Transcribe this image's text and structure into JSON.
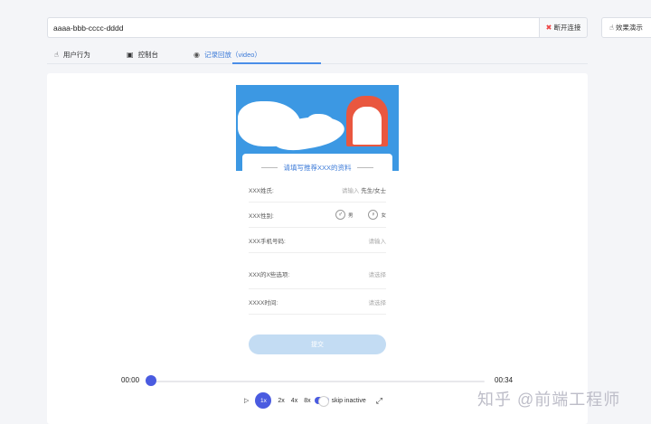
{
  "session": {
    "value": "aaaa-bbb-cccc-dddd"
  },
  "buttons": {
    "disconnect": "断开连接",
    "demo": "效果演示"
  },
  "tabs": [
    {
      "label": "用户行为",
      "icon": "pointer-icon"
    },
    {
      "label": "控制台",
      "icon": "console-icon"
    },
    {
      "label": "记录回放（video）",
      "icon": "video-icon"
    }
  ],
  "form": {
    "title": "请填写推荐XXX的资料",
    "name_label": "XXX姓氏:",
    "name_placeholder": "请输入",
    "name_suffix": "先生/女士",
    "gender_label": "XXX性别:",
    "gender_male": "男",
    "gender_female": "女",
    "phone_label": "XXX手机号码:",
    "phone_placeholder": "请输入",
    "option_label": "XXX的X些选项:",
    "option_placeholder": "请选择",
    "time_label": "XXXX时间:",
    "time_placeholder": "请选择",
    "submit": "提交"
  },
  "player": {
    "current_time": "00:00",
    "total_time": "00:34",
    "progress": 0,
    "speeds": [
      "1x",
      "2x",
      "4x",
      "8x"
    ],
    "active_speed": "1x",
    "skip_inactive_label": "skip inactive",
    "skip_inactive": true
  },
  "watermark": "知乎 @前端工程师",
  "colors": {
    "accent": "#4a5be0",
    "tab_active": "#3d7bd8",
    "banner": "#3c98e3",
    "submit_disabled": "#c3dcf3"
  }
}
